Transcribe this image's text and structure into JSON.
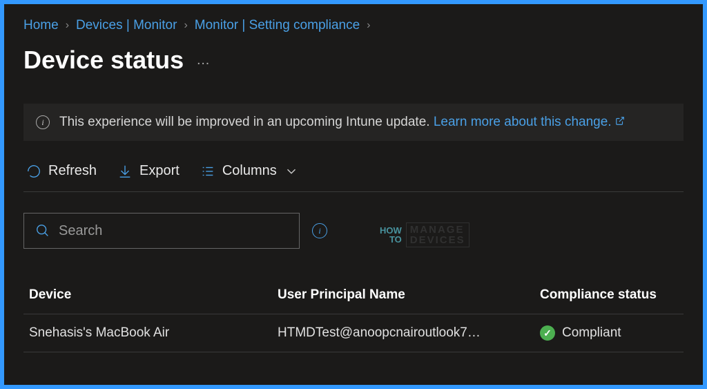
{
  "breadcrumb": {
    "items": [
      "Home",
      "Devices | Monitor",
      "Monitor | Setting compliance"
    ]
  },
  "page": {
    "title": "Device status"
  },
  "banner": {
    "text": "This experience will be improved in an upcoming Intune update.",
    "link": "Learn more about this change."
  },
  "toolbar": {
    "refresh": "Refresh",
    "export": "Export",
    "columns": "Columns"
  },
  "search": {
    "placeholder": "Search"
  },
  "watermark": {
    "l1": "HOW",
    "l2": "TO",
    "r1": "MANAGE",
    "r2": "DEVICES"
  },
  "table": {
    "headers": {
      "device": "Device",
      "upn": "User Principal Name",
      "status": "Compliance status"
    },
    "rows": [
      {
        "device": "Snehasis's MacBook Air",
        "upn": "HTMDTest@anoopcnairoutlook7…",
        "status": "Compliant"
      }
    ]
  }
}
